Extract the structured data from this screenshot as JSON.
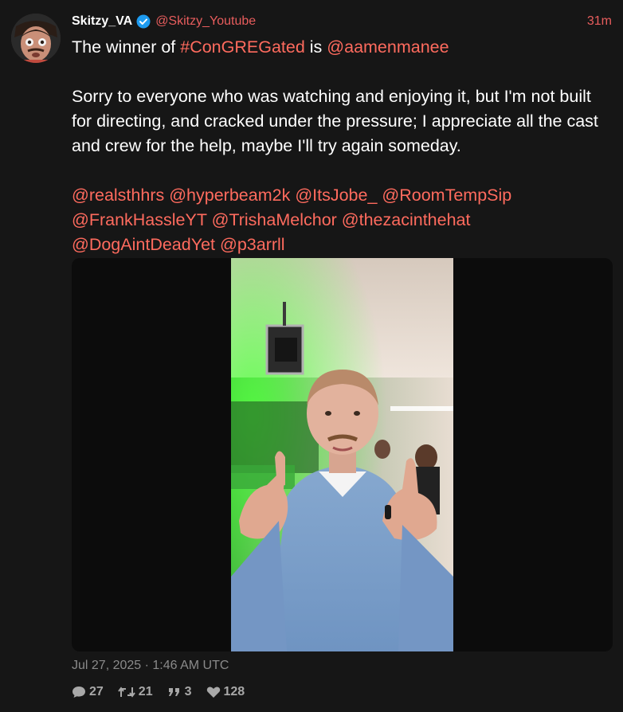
{
  "author": {
    "display_name": "Skitzy_VA",
    "handle": "@Skitzy_Youtube",
    "verified_icon": "verified-badge-icon"
  },
  "timestamp": "31m",
  "content": {
    "line1_prefix": "The winner of ",
    "hashtag": "#ConGREGated",
    "line1_mid": " is ",
    "winner_mention": "@aamenmanee",
    "paragraph": "Sorry to everyone who was watching and enjoying it, but I'm not built for directing, and cracked under the pressure; I appreciate all the cast and crew for the help, maybe I'll try again someday.",
    "mentions": [
      "@realsthhrs",
      "@hyperbeam2k",
      "@ItsJobe_",
      "@RoomTempSip",
      "@FrankHassleYT",
      "@TrishaMelchor",
      "@thezacinthehat",
      "@DogAintDeadYet",
      "@p3arrll"
    ]
  },
  "media": {
    "icon": "photo-of-man-giving-thumbs-up"
  },
  "date": "Jul 27, 2025 · 1:46 AM UTC",
  "stats": {
    "replies": "27",
    "retweets": "21",
    "quotes": "3",
    "likes": "128"
  },
  "colors": {
    "background": "#161616",
    "accent": "#ff6b5e",
    "verified": "#1d9bf0"
  }
}
